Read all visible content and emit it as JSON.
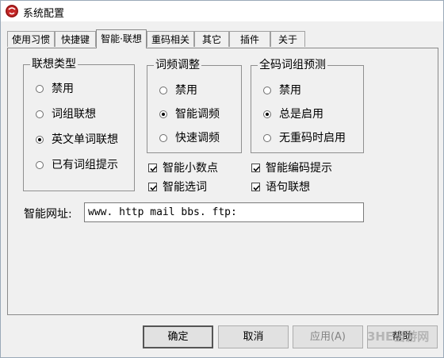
{
  "window": {
    "title": "系统配置"
  },
  "tabs": [
    {
      "label": "使用习惯"
    },
    {
      "label": "快捷键"
    },
    {
      "label": "智能·联想"
    },
    {
      "label": "重码相关"
    },
    {
      "label": "其它"
    },
    {
      "label": "插件"
    },
    {
      "label": "关于"
    }
  ],
  "active_tab": "智能·联想",
  "groups": {
    "association_type": {
      "title": "联想类型",
      "options": [
        {
          "label": "禁用",
          "selected": false
        },
        {
          "label": "词组联想",
          "selected": false
        },
        {
          "label": "英文单词联想",
          "selected": true
        },
        {
          "label": "已有词组提示",
          "selected": false
        }
      ]
    },
    "frequency": {
      "title": "词频调整",
      "options": [
        {
          "label": "禁用",
          "selected": false
        },
        {
          "label": "智能调频",
          "selected": true
        },
        {
          "label": "快速调频",
          "selected": false
        }
      ]
    },
    "fullcode": {
      "title": "全码词组预测",
      "options": [
        {
          "label": "禁用",
          "selected": false
        },
        {
          "label": "总是启用",
          "selected": true
        },
        {
          "label": "无重码时启用",
          "selected": false
        }
      ]
    }
  },
  "checkboxes": [
    {
      "label": "智能小数点",
      "checked": true
    },
    {
      "label": "智能编码提示",
      "checked": true
    },
    {
      "label": "智能选词",
      "checked": true
    },
    {
      "label": "语句联想",
      "checked": true
    }
  ],
  "url": {
    "label": "智能网址:",
    "value": "www. http mail bbs. ftp:"
  },
  "buttons": {
    "ok": "确定",
    "cancel": "取消",
    "apply": "应用(A)",
    "help": "帮助"
  },
  "watermark": "3HE当游网"
}
